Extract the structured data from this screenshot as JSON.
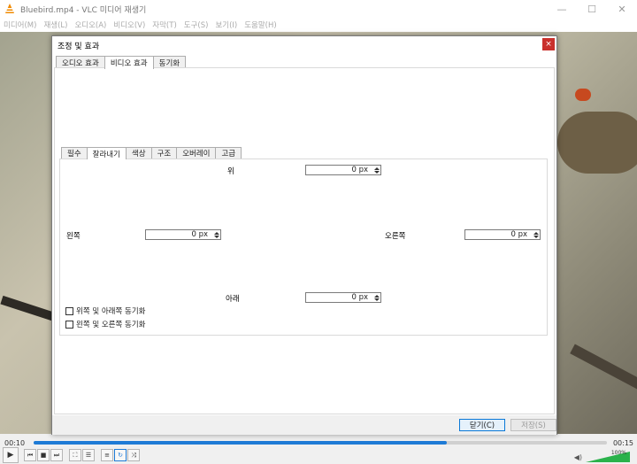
{
  "window": {
    "title": "Bluebird.mp4 - VLC 미디어 재생기",
    "controls": {
      "minimize": "—",
      "maximize": "☐",
      "close": "✕"
    }
  },
  "menu": [
    "미디어(M)",
    "재생(L)",
    "오디오(A)",
    "비디오(V)",
    "자막(T)",
    "도구(S)",
    "보기(I)",
    "도움말(H)"
  ],
  "player": {
    "time_elapsed": "00:10",
    "time_total": "00:15",
    "progress": 0.72,
    "volume_label": "100%",
    "volume": 1.0
  },
  "dialog": {
    "title": "조정 및 효과",
    "close": "×",
    "outer_tabs": [
      "오디오 효과",
      "비디오 효과",
      "동기화"
    ],
    "inner_tabs": [
      "필수",
      "잘라내기",
      "색상",
      "구조",
      "오버레이",
      "고급"
    ],
    "crop": {
      "top_label": "위",
      "top_value": "0 px",
      "left_label": "왼쪽",
      "left_value": "0 px",
      "right_label": "오른쪽",
      "right_value": "0 px",
      "bottom_label": "아래",
      "bottom_value": "0 px",
      "sync_top_bottom": "위쪽 및 아래쪽 동기화",
      "sync_left_right": "왼쪽 및 오른쪽 동기화"
    },
    "buttons": {
      "close": "닫기(C)",
      "save": "저장(S)"
    }
  },
  "colors": {
    "accent": "#1e7bd6",
    "close_red": "#c9302c"
  }
}
